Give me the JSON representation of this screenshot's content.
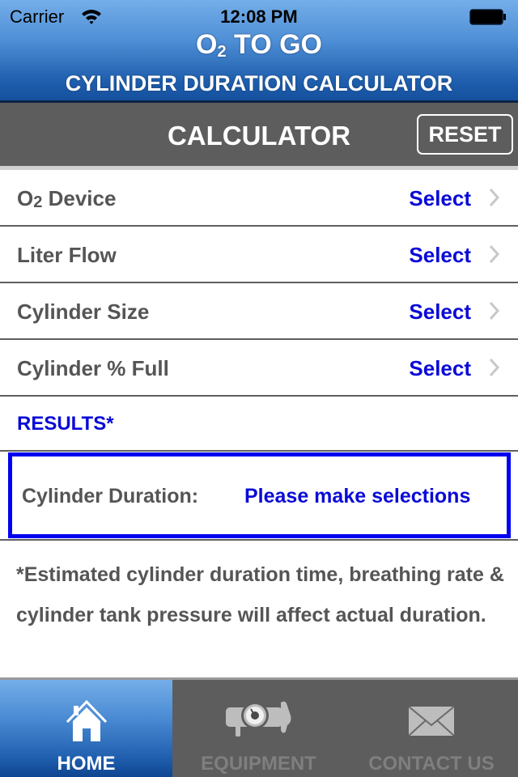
{
  "status_bar": {
    "carrier": "Carrier",
    "time": "12:08 PM",
    "wifi_icon": "wifi-icon",
    "battery_icon": "battery-full-icon"
  },
  "header": {
    "title_prefix": "O",
    "title_sub": "2",
    "title_suffix": " TO GO",
    "subtitle": "CYLINDER DURATION CALCULATOR"
  },
  "toolbar": {
    "title": "CALCULATOR",
    "reset_label": "RESET"
  },
  "rows": [
    {
      "label_prefix": "O",
      "label_sub": "2",
      "label_suffix": " Device",
      "value": "Select",
      "icon": "chevron-right-icon"
    },
    {
      "label": "Liter Flow",
      "value": "Select",
      "icon": "chevron-right-icon"
    },
    {
      "label": "Cylinder Size",
      "value": "Select",
      "icon": "chevron-right-icon"
    },
    {
      "label": "Cylinder % Full",
      "value": "Select",
      "icon": "chevron-right-icon"
    }
  ],
  "results": {
    "header": "RESULTS*",
    "duration_label": "Cylinder Duration:",
    "duration_value": "Please make selections"
  },
  "disclaimer": "*Estimated cylinder duration time, breathing rate & cylinder tank pressure will affect actual duration.",
  "tabs": [
    {
      "label": "HOME",
      "icon": "home-icon",
      "active": true
    },
    {
      "label": "EQUIPMENT",
      "icon": "oxygen-regulator-icon",
      "active": false
    },
    {
      "label": "CONTACT US",
      "icon": "envelope-icon",
      "active": false
    }
  ],
  "colors": {
    "header_blue": "#1f5fae",
    "toolbar_gray": "#5d5d5d",
    "accent_blue": "#0a0ad8",
    "results_border": "#0000f0",
    "label_gray": "#555555"
  }
}
